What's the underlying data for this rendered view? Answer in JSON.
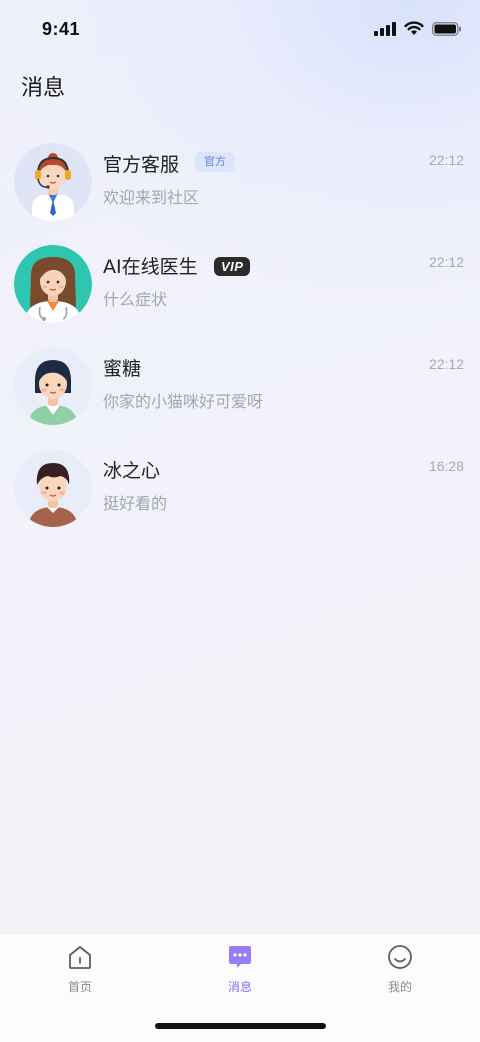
{
  "status_bar": {
    "time": "9:41"
  },
  "page": {
    "title": "消息"
  },
  "conversations": [
    {
      "name": "官方客服",
      "badge": "官方",
      "message": "欢迎来到社区",
      "time": "22:12",
      "avatar": "customer-service-avatar"
    },
    {
      "name": "AI在线医生",
      "badge": "VIP",
      "message": "什么症状",
      "time": "22:12",
      "avatar": "doctor-avatar"
    },
    {
      "name": "蜜糖",
      "message": "你家的小猫咪好可爱呀",
      "time": "22:12",
      "avatar": "girl-avatar"
    },
    {
      "name": "冰之心",
      "message": "挺好看的",
      "time": "16:28",
      "avatar": "boy-avatar"
    }
  ],
  "tabbar": {
    "items": [
      {
        "label": "首页",
        "icon": "home-icon",
        "active": false
      },
      {
        "label": "消息",
        "icon": "message-icon",
        "active": true
      },
      {
        "label": "我的",
        "icon": "profile-icon",
        "active": false
      }
    ]
  },
  "colors": {
    "accent": "#8a6cf0",
    "official_badge_bg": "#dde5fb",
    "official_badge_text": "#5b7fde",
    "vip_badge_bg": "#2b2b2b"
  }
}
